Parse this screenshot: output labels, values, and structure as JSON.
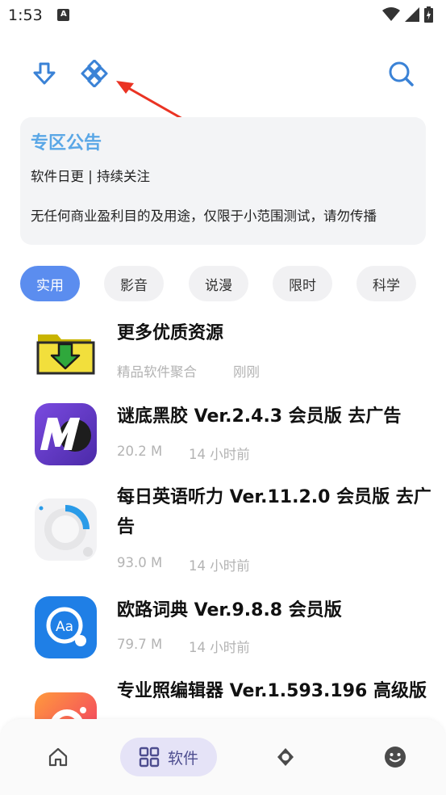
{
  "status_bar": {
    "time": "1:53",
    "notification_letter": "A"
  },
  "notice": {
    "title": "专区公告",
    "subtitle": "软件日更 | 持续关注",
    "body": "无任何商业盈利目的及用途，仅限于小范围测试，请勿传播"
  },
  "categories": [
    {
      "label": "实用",
      "active": true
    },
    {
      "label": "影音",
      "active": false
    },
    {
      "label": "说漫",
      "active": false
    },
    {
      "label": "限时",
      "active": false
    },
    {
      "label": "科学",
      "active": false
    }
  ],
  "apps": [
    {
      "title": "更多优质资源",
      "meta_left": "精品软件聚合",
      "meta_right": "刚刚",
      "icon": "folder-download-icon"
    },
    {
      "title": "谜底黑胶 Ver.2.4.3 会员版 去广告",
      "meta_left": "20.2 M",
      "meta_right": "14 小时前",
      "icon": "vinyl-m-icon"
    },
    {
      "title": "每日英语听力 Ver.11.2.0 会员版 去广告",
      "meta_left": "93.0 M",
      "meta_right": "14 小时前",
      "icon": "english-listening-icon"
    },
    {
      "title": "欧路词典 Ver.9.8.8 会员版",
      "meta_left": "79.7 M",
      "meta_right": "14 小时前",
      "icon": "eudic-dictionary-icon"
    },
    {
      "title": "专业照编辑器 Ver.1.593.196 高级版",
      "meta_left": "",
      "meta_right": "",
      "icon": "photo-editor-icon"
    }
  ],
  "bottom_nav": {
    "active_label": "软件"
  },
  "colors": {
    "accent": "#5b8def",
    "notice_title": "#5aa7e6",
    "nav_pill": "#e5e3f7"
  }
}
